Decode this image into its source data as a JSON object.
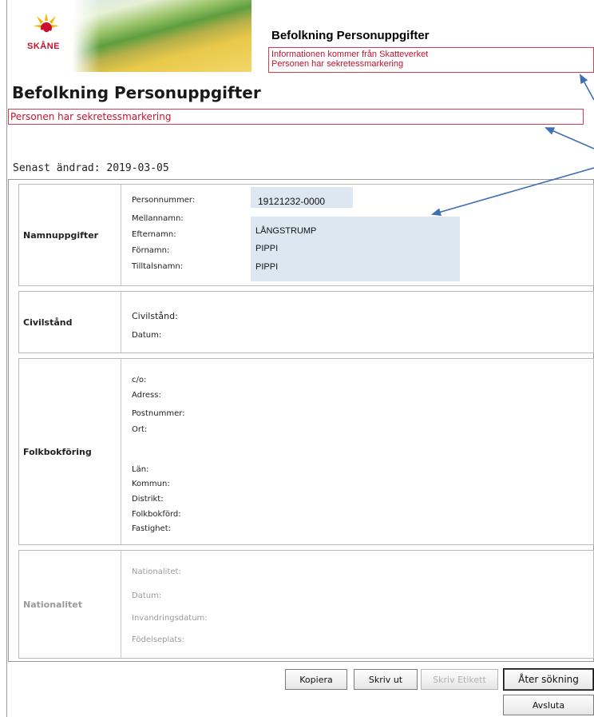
{
  "header": {
    "logo_text": "SKÅNE",
    "title": "Befolkning Personuppgifter",
    "notice_lines": [
      "Informationen kommer från Skatteverket",
      "Personen har sekretessmarkering"
    ]
  },
  "page": {
    "title": "Befolkning Personuppgifter",
    "secrecy_notice": "Personen har sekretessmarkering",
    "last_changed_label": "Senast ändrad:",
    "last_changed_date": "2019-03-05"
  },
  "sections": {
    "namn": {
      "heading": "Namnuppgifter",
      "labels": [
        "Personnummer:",
        "Mellannamn:",
        "Efternamn:",
        "Förnamn:",
        "Tilltalsnamn:"
      ],
      "personnummer": "19121232-0000",
      "efternamn": "LÅNGSTRUMP",
      "fornamn": "PIPPI",
      "tilltalsnamn": "PIPPI"
    },
    "civil": {
      "heading": "Civilstånd",
      "labels": [
        "Civilstånd:",
        "Datum:"
      ]
    },
    "folk": {
      "heading": "Folkbokföring",
      "labels": [
        "c/o:",
        "Adress:",
        "Postnummer:",
        "Ort:",
        "Län:",
        "Kommun:",
        "Distrikt:",
        "Folkbokförd:",
        "Fastighet:"
      ]
    },
    "nat": {
      "heading": "Nationalitet",
      "labels": [
        "Nationalitet:",
        "Datum:",
        "Invandringsdatum:",
        "Födelseplats:"
      ]
    }
  },
  "buttons": {
    "kopiera": "Kopiera",
    "skriv_ut": "Skriv ut",
    "skriv_etikett": "Skriv Etikett",
    "ater_sokning": "Åter sökning",
    "avsluta": "Avsluta"
  },
  "colors": {
    "notice_red": "#c8102e",
    "highlight_blue": "#dde7f2",
    "arrow_blue": "#3d6fb5"
  }
}
